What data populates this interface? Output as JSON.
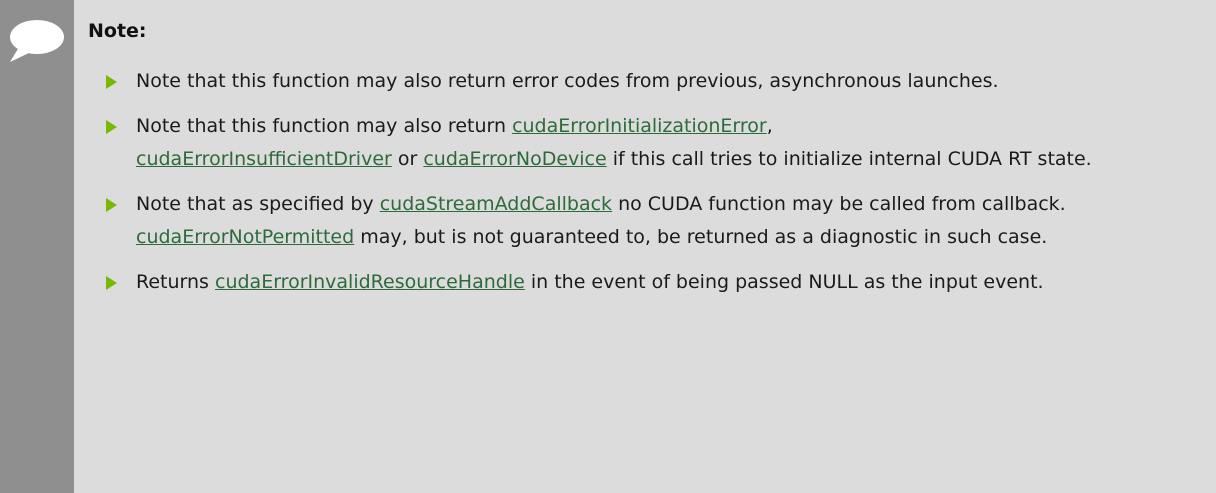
{
  "note": {
    "icon": "speech-bubble-icon",
    "title": "Note:",
    "colors": {
      "background": "#dcdcdc",
      "sidebar": "#8f8f8f",
      "bullet": "#76b900",
      "link": "#2e6a3a"
    },
    "items": [
      {
        "text_1": "Note that this function may also return error codes from previous, asynchronous launches."
      },
      {
        "text_1": "Note that this function may also return ",
        "link_1": "cudaErrorInitializationError",
        "text_2": ", ",
        "link_2": "cudaErrorInsufficientDriver",
        "text_3": " or ",
        "link_3": "cudaErrorNoDevice",
        "text_4": " if this call tries to initialize internal CUDA RT state."
      },
      {
        "text_1": "Note that as specified by ",
        "link_1": "cudaStreamAddCallback",
        "text_2": " no CUDA function may be called from callback. ",
        "link_2": "cudaErrorNotPermitted",
        "text_3": " may, but is not guaranteed to, be returned as a diagnostic in such case."
      },
      {
        "text_1": "Returns ",
        "link_1": "cudaErrorInvalidResourceHandle",
        "text_2": " in the event of being passed NULL as the input event."
      }
    ]
  }
}
